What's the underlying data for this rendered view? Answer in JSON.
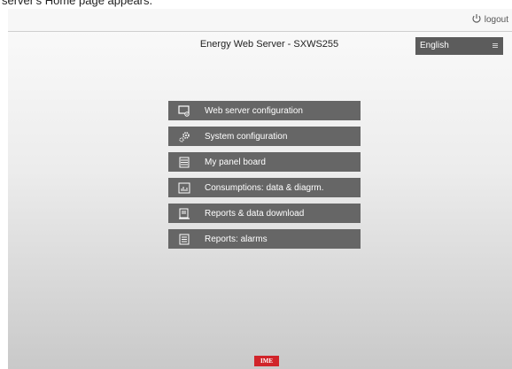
{
  "caption": "server's Home page appears.",
  "topbar": {
    "logout_label": "logout"
  },
  "header": {
    "title": "Energy Web Server - SXWS255"
  },
  "language": {
    "selected": "English"
  },
  "menu": {
    "items": [
      {
        "label": "Web server configuration",
        "icon": "web-server-config-icon"
      },
      {
        "label": "System configuration",
        "icon": "gears-icon"
      },
      {
        "label": "My panel board",
        "icon": "panel-board-icon"
      },
      {
        "label": "Consumptions: data & diagrm.",
        "icon": "chart-icon"
      },
      {
        "label": "Reports & data download",
        "icon": "report-download-icon"
      },
      {
        "label": "Reports: alarms",
        "icon": "alarm-report-icon"
      }
    ]
  },
  "footer": {
    "brand_logo": "IME"
  },
  "colors": {
    "menu_bg": "#666666",
    "lang_bg": "#5c5c5c",
    "brand": "#d1242a"
  }
}
